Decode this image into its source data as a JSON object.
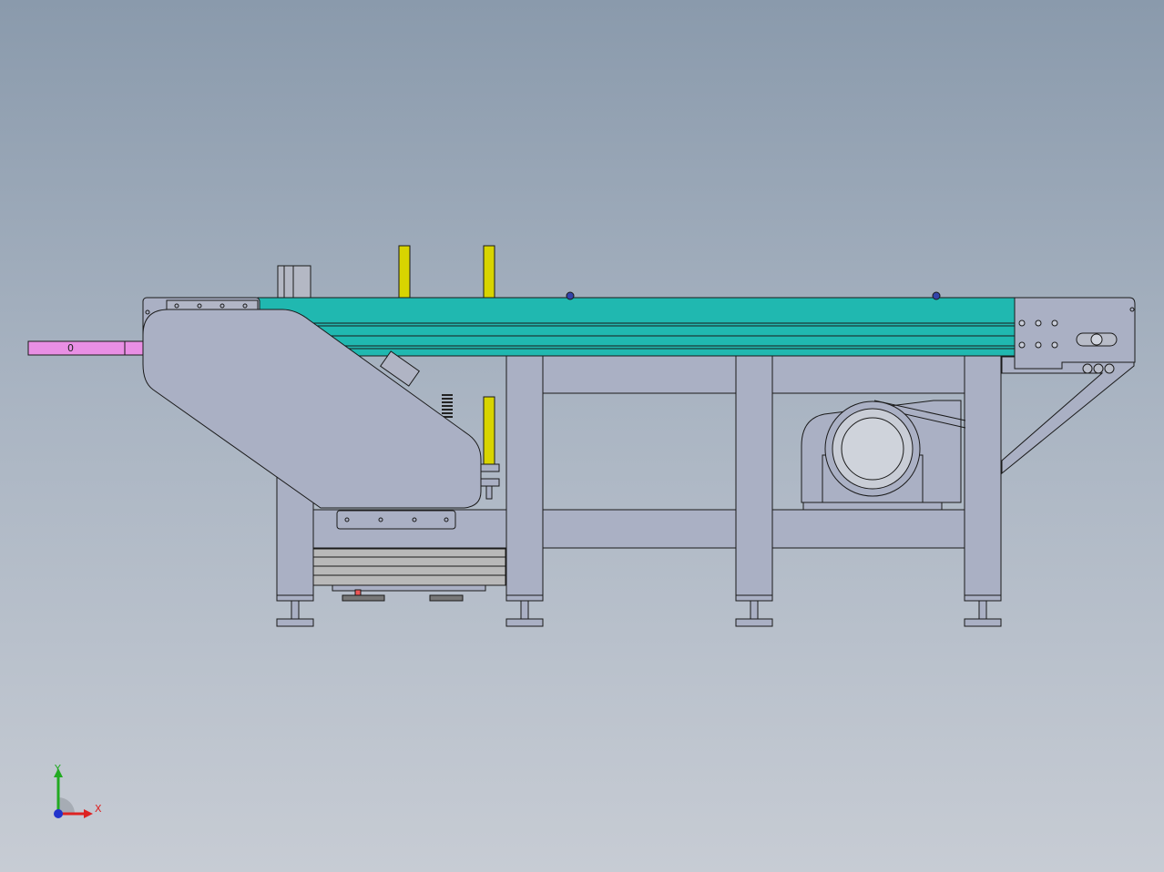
{
  "viewport": {
    "label": "conveyor-assembly-front-view"
  },
  "colors": {
    "frame": "#aab0c4",
    "frame_dark": "#9aa0b4",
    "belt": "#20b8b0",
    "belt_dark": "#169a94",
    "yellow_post": "#d8d400",
    "pink_bar": "#e98fe4",
    "motor_ring": "#c9cdd6",
    "outline": "#1a1a1a"
  },
  "triad": {
    "y_label": "Y",
    "x_label": "X",
    "y_color": "#22aa22",
    "x_color": "#dd2222",
    "z_color": "#2233cc"
  },
  "bar_label": "0"
}
